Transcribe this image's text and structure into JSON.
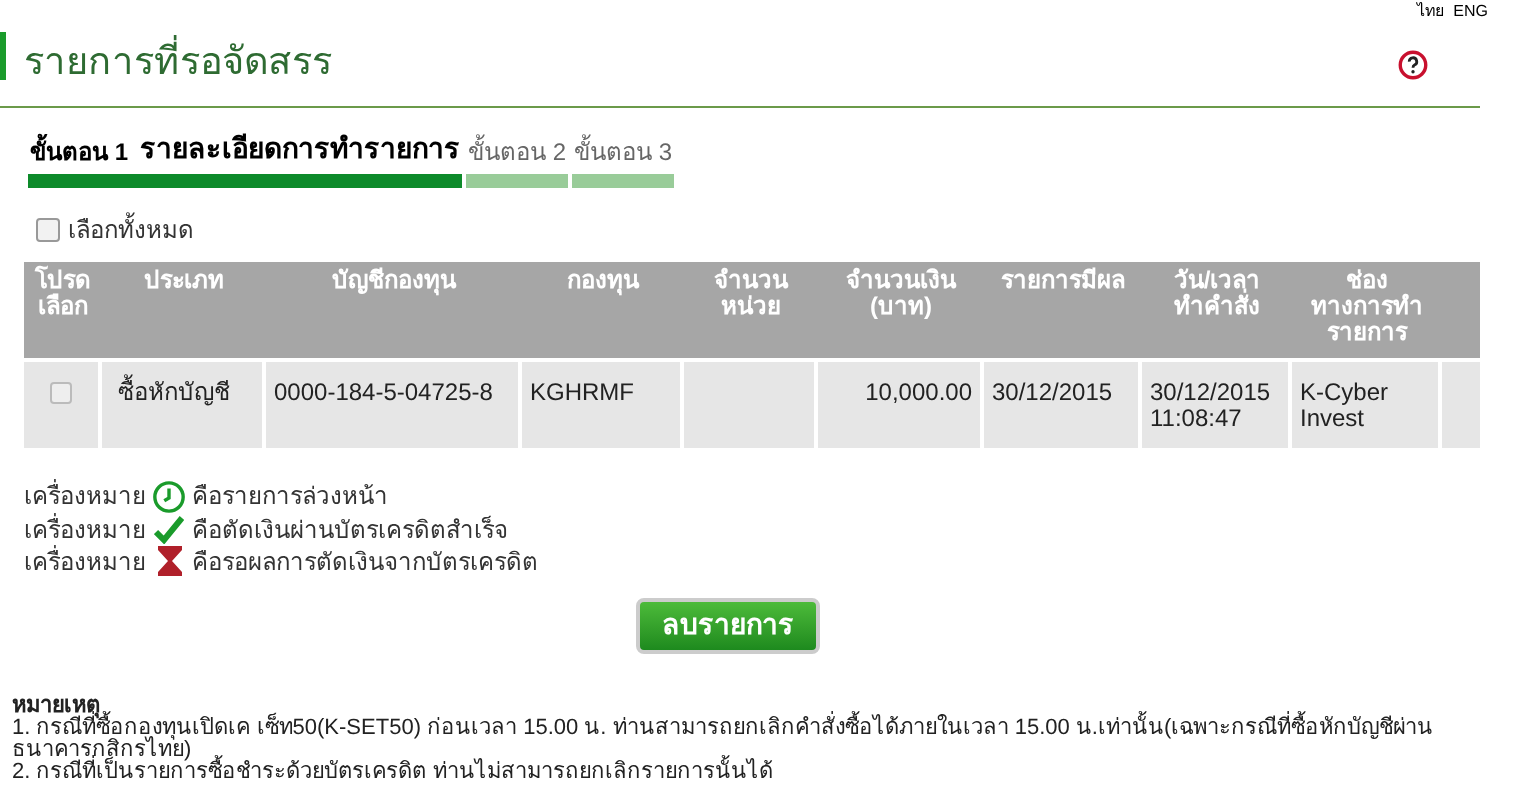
{
  "languages": [
    {
      "label": "ไทย"
    },
    {
      "label": "ENG"
    }
  ],
  "page_title": "รายการที่รอจัดสรร",
  "steps": [
    {
      "label": "ขั้นตอน 1",
      "detail": "รายละเอียดการทำรายการ",
      "selected": true
    },
    {
      "label": "ขั้นตอน 2",
      "selected": false
    },
    {
      "label": "ขั้นตอน 3",
      "selected": false
    }
  ],
  "select_all": {
    "label": "เลือกทั้งหมด",
    "checked": false
  },
  "table": {
    "columns": [
      "โปรด\nเลือก",
      "ประเภท",
      "บัญชีกองทุน",
      "กองทุน",
      "จำนวน\nหน่วย",
      "จำนวนเงิน\n(บาท)",
      "รายการมีผล",
      "วัน/เวลา\nทำคำสั่ง",
      "ช่อง\nทางการทำ\nรายการ"
    ],
    "rows": [
      {
        "checked": false,
        "type": "ซื้อหักบัญชี",
        "account": "0000-184-5-04725-8",
        "fund": "KGHRMF",
        "amount": "10,000.00",
        "effective": "30/12/2015",
        "datetime": "30/12/2015 11:08:47",
        "channel": "K-Cyber Invest"
      }
    ]
  },
  "legend": [
    {
      "kind": "clock",
      "prefix": "เครื่องหมาย",
      "text": "คือรายการล่วงหน้า"
    },
    {
      "kind": "check",
      "prefix": "เครื่องหมาย",
      "text": "คือตัดเงินผ่านบัตรเครดิตสำเร็จ"
    },
    {
      "kind": "hourglass",
      "prefix": "เครื่องหมาย",
      "text": "คือรอผลการตัดเงินจากบัตรเครดิต"
    }
  ],
  "delete_button": "ลบรายการ",
  "notes": {
    "title": "หมายเหตุ",
    "items": [
      "1. กรณีที่ซื้อกองทุนเปิดเค เซ็ท50(K-SET50) ก่อนเวลา 15.00 น. ท่านสามารถยกเลิกคำสั่งซื้อได้ภายในเวลา 15.00 น.เท่านั้น(เฉพาะกรณีที่ซื้อหักบัญชีผ่านธนาคารกสิกรไทย)",
      "2. กรณีที่เป็นรายการซื้อชำระด้วยบัตรเครดิต ท่านไม่สามารถยกเลิกรายการนั้นได้"
    ]
  }
}
